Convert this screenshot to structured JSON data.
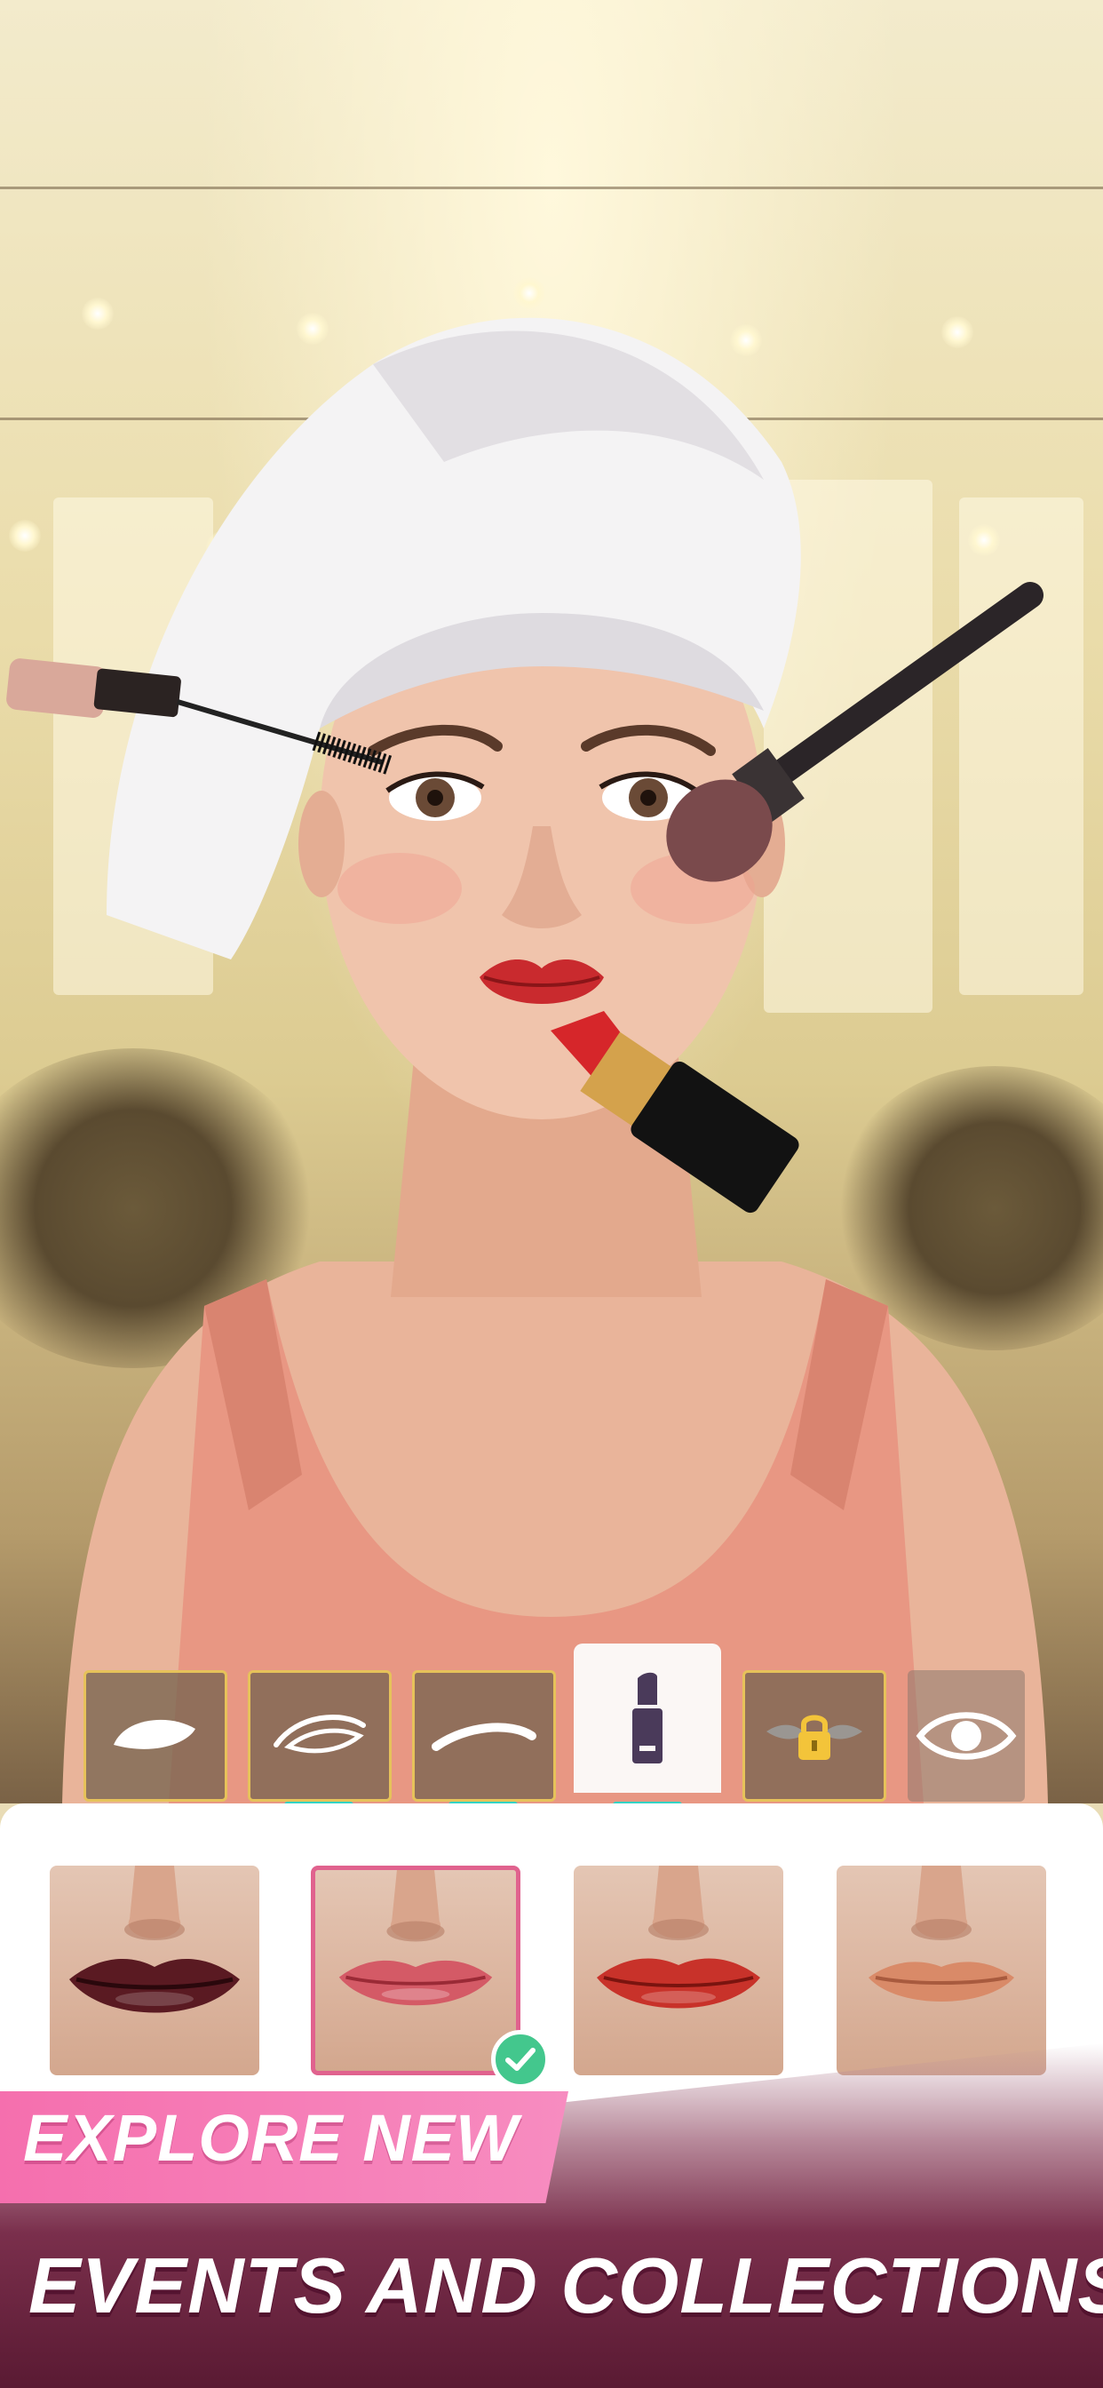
{
  "screen": "makeup-editor",
  "colors": {
    "accent_pink": "#f56fae",
    "selected_border": "#e0628e",
    "tab_indicator": "#33d3c4",
    "tab_border_gold": "#e6c25a",
    "check_green": "#43c78d",
    "banner_dark": "#5a1a33"
  },
  "toolbar": {
    "tabs": [
      {
        "id": "face-shape",
        "icon": "face-shape-icon",
        "state": "default"
      },
      {
        "id": "eye-shape",
        "icon": "eye-shape-icon",
        "state": "default"
      },
      {
        "id": "eyebrow",
        "icon": "eyebrow-icon",
        "state": "default"
      },
      {
        "id": "lipstick",
        "icon": "lipstick-icon",
        "state": "active"
      },
      {
        "id": "locked-item",
        "icon": "lock-icon",
        "state": "locked"
      },
      {
        "id": "eye-makeup",
        "icon": "eye-icon",
        "state": "default"
      }
    ]
  },
  "lip_options": [
    {
      "shade": "dark-berry",
      "color": "#5a1a22",
      "selected": false
    },
    {
      "shade": "rose-pink",
      "color": "#d45a66",
      "selected": true
    },
    {
      "shade": "classic-red",
      "color": "#c8322a",
      "selected": false
    },
    {
      "shade": "nude-peach",
      "color": "#d98a68",
      "selected": false
    }
  ],
  "promo": {
    "line1": "EXPLORE NEW",
    "line2": "EVENTS AND COLLECTIONS"
  }
}
